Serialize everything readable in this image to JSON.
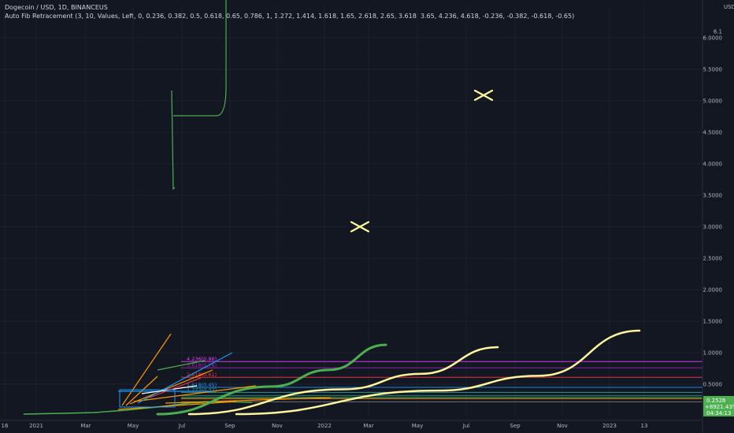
{
  "chart_data": {
    "type": "line",
    "title": "Dogecoin / USD, 1D, BINANCEUS",
    "subtitle": "Auto Fib Retracement (3, 10, Values, Left, 0, 0.236, 0.382, 0.5, 0.618, 0.65, 0.786, 1, 1.272, 1.414, 1.618, 1.65, 2.618, 2.65, 3.618, 3.65, 4.236, 4.618, -0.236, -0.382, -0.618, -0.65)",
    "y_axis": {
      "ylim": [
        0,
        6.1
      ],
      "ticks": [
        {
          "value": 6.1,
          "label": "6.1"
        },
        {
          "value": 6.0,
          "label": "6.0000"
        },
        {
          "value": 5.5,
          "label": "5.5000"
        },
        {
          "value": 5.0,
          "label": "5.0000"
        },
        {
          "value": 4.5,
          "label": "4.5000"
        },
        {
          "value": 4.0,
          "label": "4.0000"
        },
        {
          "value": 3.5,
          "label": "3.5000"
        },
        {
          "value": 3.0,
          "label": "3.0000"
        },
        {
          "value": 2.5,
          "label": "2.5000"
        },
        {
          "value": 2.0,
          "label": "2.0000"
        },
        {
          "value": 1.5,
          "label": "1.5000"
        },
        {
          "value": 1.0,
          "label": "1.0000"
        },
        {
          "value": 0.5,
          "label": "0.5000"
        }
      ],
      "currency": "USD"
    },
    "x_axis": {
      "ticks": [
        "16",
        "2021",
        "Mar",
        "May",
        "Jul",
        "Sep",
        "Nov",
        "2022",
        "Mar",
        "May",
        "Jul",
        "Sep",
        "Nov",
        "2023",
        "13"
      ]
    },
    "grid": true,
    "current_price": {
      "value": 0.2526,
      "label": "0.2526",
      "change": "+8921.43%",
      "countdown": "04:34:13"
    },
    "fib_levels": [
      {
        "value": 0.86,
        "label": "4.236(0.86)",
        "color": "#e040fb"
      },
      {
        "value": 0.76,
        "label": "3.618(0.76)",
        "color": "#9c27b0"
      },
      {
        "value": 0.61,
        "label": "2.618(0.61)",
        "color": "#f23645"
      },
      {
        "value": 0.45,
        "label": "1.618(0.45)",
        "color": "#2196f3"
      },
      {
        "value": 0.37,
        "label": "1.272(0.37)",
        "color": "#26a69a"
      },
      {
        "value": 0.32,
        "label": "",
        "color": "#089981"
      },
      {
        "value": 0.29,
        "label": "",
        "color": "#4caf50"
      },
      {
        "value": 0.27,
        "label": "",
        "color": "#ff9800"
      },
      {
        "value": 0.22,
        "label": "",
        "color": "#787b86"
      }
    ],
    "projection_curves": [
      {
        "color": "#4caf50",
        "points": [
          [
            0.0,
            0.0
          ],
          [
            0.5,
            0.45
          ],
          [
            0.75,
            0.72
          ],
          [
            1.0,
            1.13
          ]
        ]
      },
      {
        "color": "#fff59d",
        "points": [
          [
            0.0,
            0.0
          ],
          [
            0.5,
            0.4
          ],
          [
            0.75,
            0.65
          ],
          [
            1.0,
            1.08
          ]
        ]
      },
      {
        "color": "#fff59d",
        "points": [
          [
            0.0,
            0.0
          ],
          [
            0.5,
            0.38
          ],
          [
            0.75,
            0.62
          ],
          [
            1.0,
            1.35
          ]
        ]
      }
    ],
    "drawing_colors": {
      "price_line": "#4caf50",
      "cross_marker": "#fff59d",
      "price_box": "#4caf50",
      "trendlines": [
        "#ff9800",
        "#2196f3",
        "#4caf50",
        "#ffffff",
        "#f23645"
      ]
    }
  }
}
